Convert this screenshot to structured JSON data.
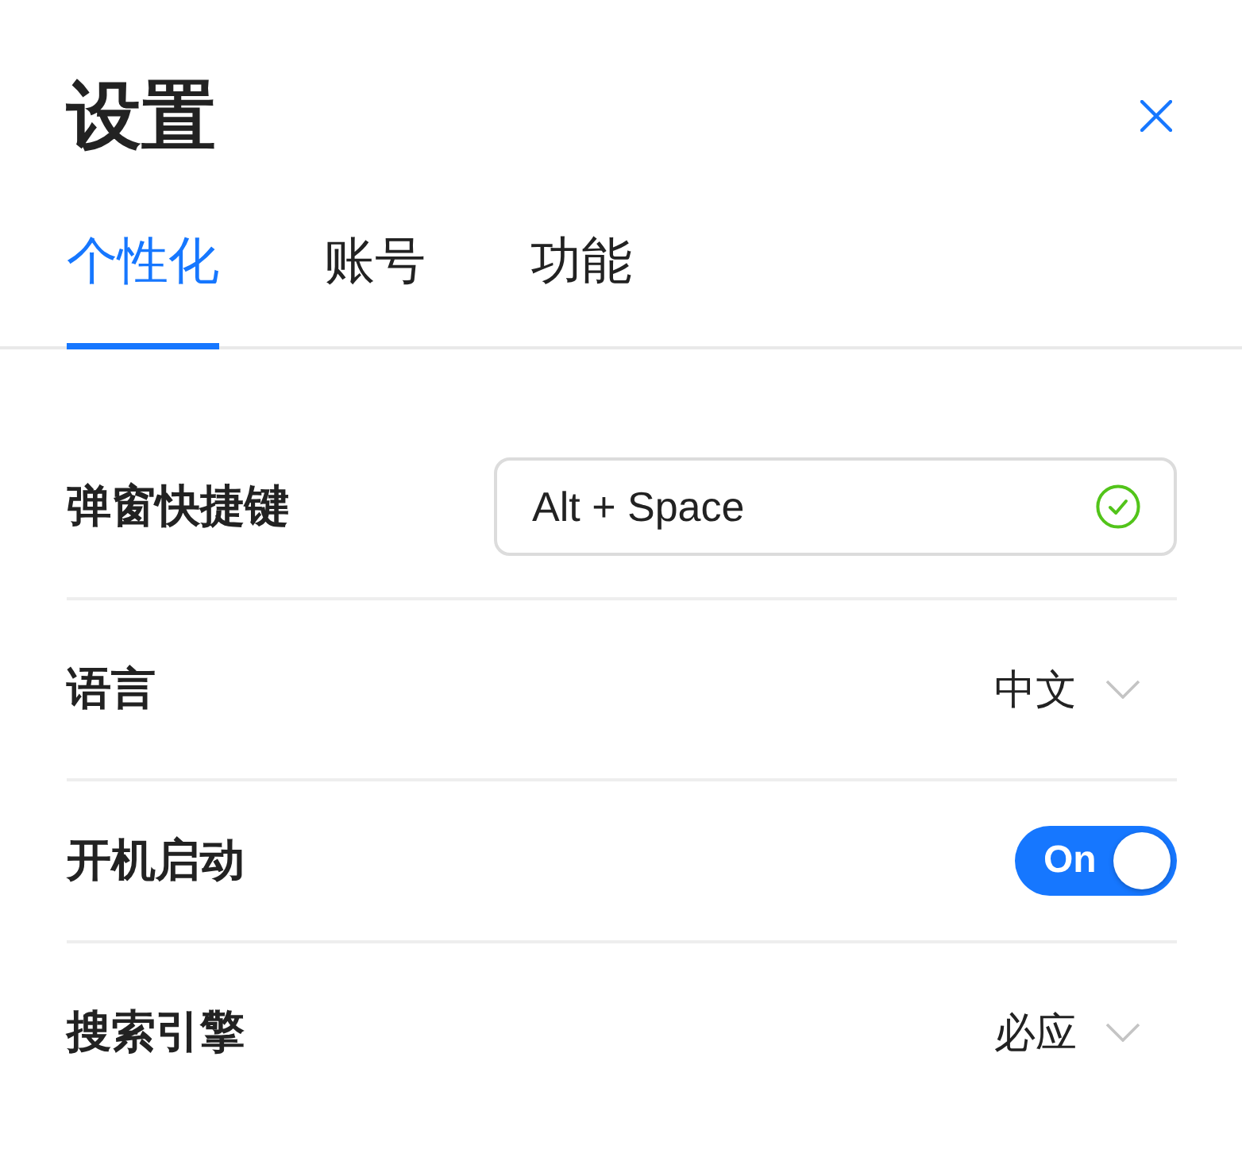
{
  "window": {
    "title": "设置"
  },
  "tabs": [
    {
      "label": "个性化",
      "selected": true
    },
    {
      "label": "账号",
      "selected": false
    },
    {
      "label": "功能",
      "selected": false
    }
  ],
  "settings": [
    {
      "kind": "shortcut",
      "label": "弹窗快捷键",
      "value": "Alt + Space",
      "valid": true
    },
    {
      "kind": "select",
      "label": "语言",
      "value": "中文"
    },
    {
      "kind": "toggle",
      "label": "开机启动",
      "on": true,
      "text": "On"
    },
    {
      "kind": "select",
      "label": "搜索引擎",
      "value": "必应"
    }
  ]
}
